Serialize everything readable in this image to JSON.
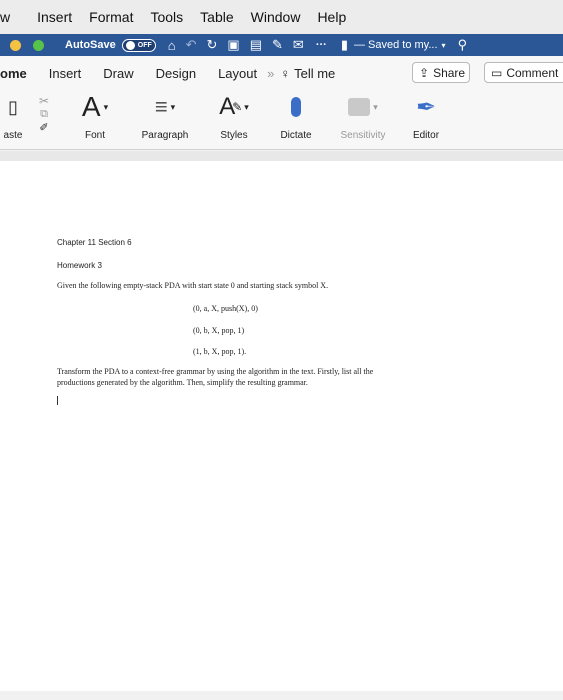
{
  "menubar": {
    "items": [
      "w",
      "Insert",
      "Format",
      "Tools",
      "Table",
      "Window",
      "Help"
    ]
  },
  "titlebar": {
    "autosave_label": "AutoSave",
    "autosave_state": "OFF",
    "saved_status": "— Saved to my...",
    "more": "···"
  },
  "tabs": {
    "items": [
      "ome",
      "Insert",
      "Draw",
      "Design",
      "Layout"
    ],
    "overflow": "»",
    "tell_me": "Tell me",
    "share": "Share",
    "comments": "Comment"
  },
  "ribbon": {
    "paste": "aste",
    "font": "Font",
    "font_glyph": "A",
    "paragraph": "Paragraph",
    "styles": "Styles",
    "dictate": "Dictate",
    "sensitivity": "Sensitivity",
    "editor": "Editor"
  },
  "document": {
    "heading": "Chapter 11 Section 6",
    "homework": "Homework 3",
    "question": "Given the following empty-stack PDA with start state 0 and starting stack symbol X.",
    "transitions": [
      "(0, a, X, push(X), 0)",
      "(0, b, X, pop, 1)",
      "(1, b, X, pop, 1)."
    ],
    "instruction_line1": "Transform the PDA to a context-free grammar by using the algorithm in the text. Firstly, list all the",
    "instruction_line2": "productions generated by the algorithm. Then, simplify the resulting grammar."
  },
  "colors": {
    "titlebar": "#2b5797",
    "dot_left": "#f5c242",
    "dot_right": "#58c34a"
  }
}
